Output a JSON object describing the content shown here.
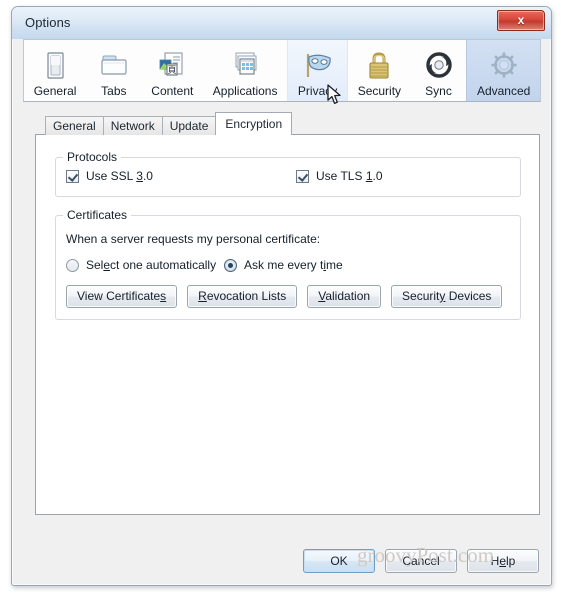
{
  "window": {
    "title": "Options",
    "close_label": "x",
    "close_icon": "close-icon",
    "accent_selected": "#c2d4ec",
    "accent_hover": "#e2ecfa",
    "titlebar_color": "#cfe0f2",
    "close_color": "#c13a2d"
  },
  "toolbar": {
    "items": [
      {
        "label": "General",
        "icon": "switch-panel-icon",
        "state": "normal"
      },
      {
        "label": "Tabs",
        "icon": "folder-tabs-icon",
        "state": "normal"
      },
      {
        "label": "Content",
        "icon": "page-image-icon",
        "state": "normal"
      },
      {
        "label": "Applications",
        "icon": "app-windows-icon",
        "state": "normal"
      },
      {
        "label": "Privacy",
        "icon": "mask-icon",
        "state": "hovered"
      },
      {
        "label": "Security",
        "icon": "padlock-icon",
        "state": "normal"
      },
      {
        "label": "Sync",
        "icon": "sync-arrows-icon",
        "state": "normal"
      },
      {
        "label": "Advanced",
        "icon": "gear-icon",
        "state": "selected"
      }
    ]
  },
  "subtabs": [
    {
      "label": "General",
      "active": false
    },
    {
      "label": "Network",
      "active": false
    },
    {
      "label": "Update",
      "active": false
    },
    {
      "label": "Encryption",
      "active": true
    }
  ],
  "protocols": {
    "legend": "Protocols",
    "items": [
      {
        "pre": "Use SSL ",
        "accel": "3",
        "post": ".0",
        "checked": true
      },
      {
        "pre": "Use TLS ",
        "accel": "1",
        "post": ".0",
        "checked": true
      }
    ]
  },
  "certificates": {
    "legend": "Certificates",
    "question": "When a server requests my personal certificate:",
    "options": [
      {
        "pre": "Sel",
        "accel": "e",
        "post": "ct one automatically",
        "selected": false
      },
      {
        "pre": "Ask me every t",
        "accel": "i",
        "post": "me",
        "selected": true
      }
    ],
    "buttons": [
      {
        "pre": "View Certificate",
        "accel": "s",
        "post": ""
      },
      {
        "pre": "",
        "accel": "R",
        "post": "evocation Lists"
      },
      {
        "pre": "",
        "accel": "V",
        "post": "alidation"
      },
      {
        "pre": "Securit",
        "accel": "y",
        "post": " Devices"
      }
    ]
  },
  "footer": {
    "buttons": [
      {
        "pre": "OK",
        "accel": "",
        "post": "",
        "default": true
      },
      {
        "pre": "Cancel",
        "accel": "",
        "post": "",
        "default": false
      },
      {
        "pre": "H",
        "accel": "e",
        "post": "lp",
        "default": false
      }
    ]
  },
  "watermark": {
    "text": "groovyPost.com"
  }
}
